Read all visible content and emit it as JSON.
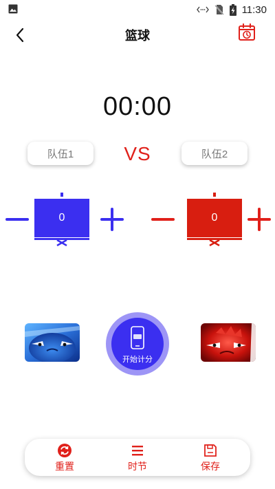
{
  "status_bar": {
    "time": "11:30"
  },
  "app_bar": {
    "title": "篮球"
  },
  "timer": {
    "display": "00:00"
  },
  "match": {
    "vs_label": "VS"
  },
  "teams": [
    {
      "name": "队伍1",
      "score": "0",
      "color": "#3b2ff0"
    },
    {
      "name": "队伍2",
      "score": "0",
      "color": "#d81e10"
    }
  ],
  "start_button": {
    "label": "开始计分",
    "color": "#3b2ff0"
  },
  "bottom_nav": [
    {
      "label": "重置",
      "icon": "reset-icon"
    },
    {
      "label": "时节",
      "icon": "menu-lines-icon"
    },
    {
      "label": "保存",
      "icon": "save-icon"
    }
  ],
  "accent_colors": {
    "red": "#e0201a",
    "blue": "#3b2ff0"
  }
}
